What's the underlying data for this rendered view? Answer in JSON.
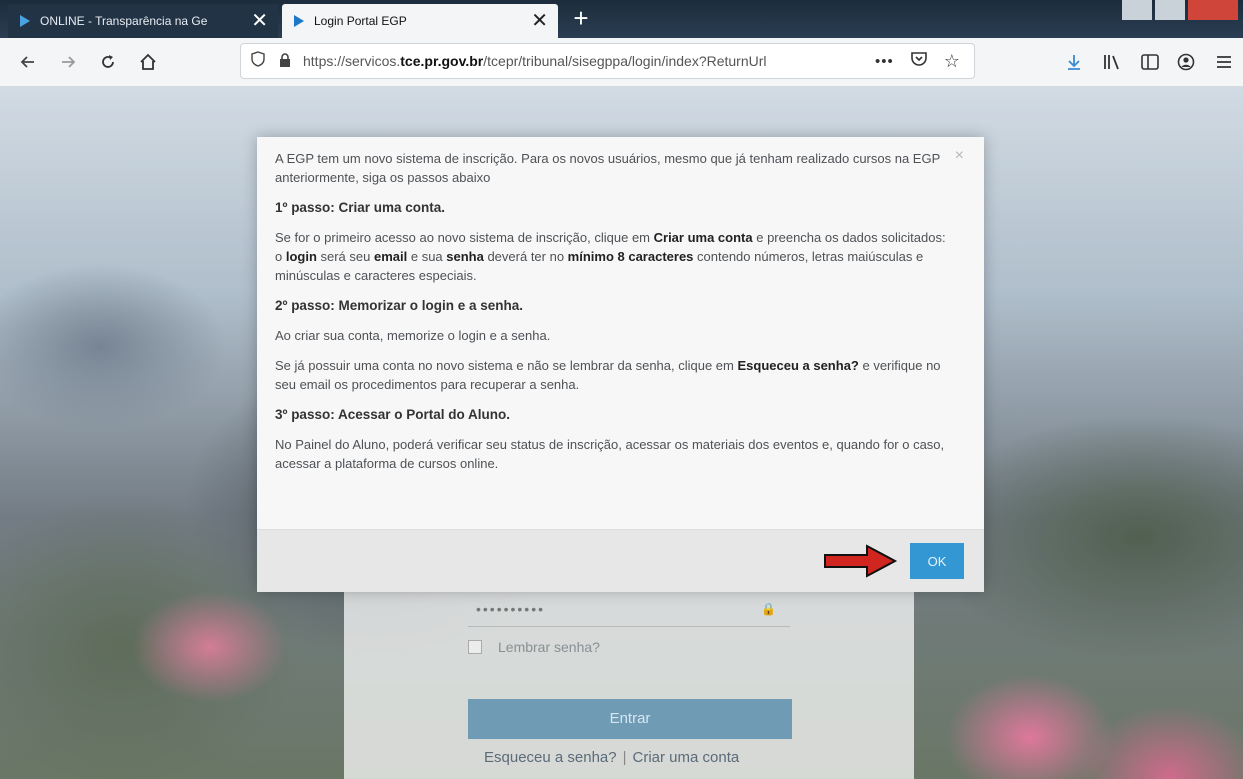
{
  "browser": {
    "tabs": [
      {
        "label": "ONLINE - Transparência na Ge",
        "active": false
      },
      {
        "label": "Login Portal EGP",
        "active": true
      }
    ],
    "new_tab": "+",
    "url": {
      "prefix": "https://servicos.",
      "domain": "tce.pr.gov.br",
      "path": "/tcepr/tribunal/sisegppa/login/index?ReturnUrl"
    },
    "page_actions": "•••",
    "colors": {
      "tab_bar": "#1c2c3c",
      "toolbar": "#f3f5f7",
      "download_icon": "#3a8ad6"
    }
  },
  "modal": {
    "intro": "A EGP tem um novo sistema de inscrição. Para os novos usuários, mesmo que já tenham realizado cursos na EGP anteriormente, siga os passos abaixo",
    "step1_title": "1º passo: Criar uma conta.",
    "step1_text": {
      "t1": "Se for o primeiro acesso ao novo sistema de inscrição, clique em ",
      "b1": "Criar uma conta",
      "t2": " e preencha os dados solicitados: o ",
      "b2": "login",
      "t3": " será seu ",
      "b3": "email",
      "t4": " e sua ",
      "b4": "senha",
      "t5": " deverá ter no ",
      "b5": "mínimo 8 caracteres",
      "t6": " contendo números, letras maiúsculas e minúsculas e caracteres especiais."
    },
    "step2_title": "2º passo: Memorizar o login e a senha.",
    "step2_text": "Ao criar sua conta, memorize o login e a senha.",
    "step2_extra": {
      "t1": "Se já possuir uma conta no novo sistema e não se lembrar da senha, clique em ",
      "b1": "Esqueceu a senha?",
      "t2": " e verifique no seu email os procedimentos para recuperar a senha."
    },
    "step3_title": "3º passo: Acessar o Portal do Aluno.",
    "step3_text": "No Painel do Aluno, poderá verificar seu status de inscrição, acessar os materiais dos eventos e, quando for o caso, acessar a plataforma de cursos online.",
    "close": "×",
    "ok_label": "OK",
    "colors": {
      "ok_button": "#3397d3",
      "arrow": "#d0261f"
    }
  },
  "login": {
    "password_mask": "••••••••••",
    "remember_label": "Lembrar senha?",
    "submit_label": "Entrar",
    "forgot_link": "Esqueceu a senha?",
    "separator": "|",
    "create_link": "Criar uma conta"
  }
}
